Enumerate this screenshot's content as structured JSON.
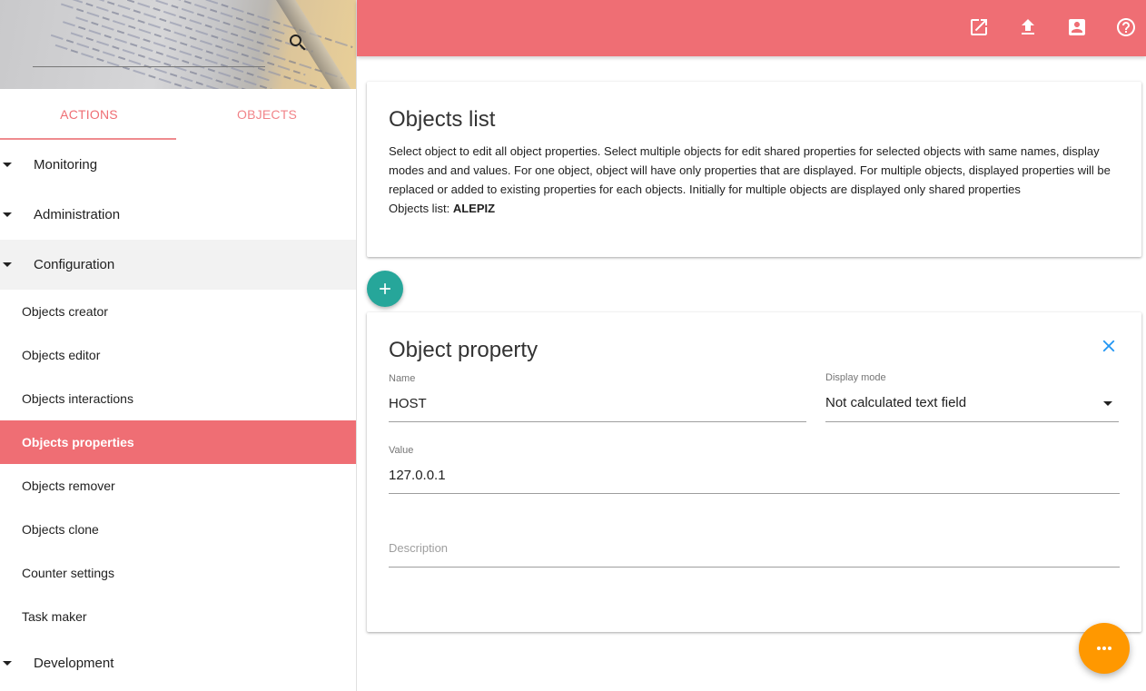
{
  "sidebar": {
    "tabs": {
      "actions": "ACTIONS",
      "objects": "OBJECTS"
    },
    "groups": {
      "monitoring": "Monitoring",
      "administration": "Administration",
      "configuration": "Configuration",
      "development": "Development"
    },
    "items": [
      "Objects creator",
      "Objects editor",
      "Objects interactions",
      "Objects properties",
      "Objects remover",
      "Objects clone",
      "Counter settings",
      "Task maker"
    ],
    "selected_item": "Objects properties"
  },
  "topbar": {
    "icons": [
      "open-in-new-icon",
      "upload-icon",
      "contact-card-icon",
      "help-icon"
    ],
    "color": "#ef6e74"
  },
  "objects_list_card": {
    "title": "Objects list",
    "description": "Select object to edit all object properties. Select multiple objects for edit shared properties for selected objects with same names, display modes and and values. For one object, object will have only properties that are displayed. For multiple objects, displayed properties will be replaced or added to existing properties for each objects. Initially for multiple objects are displayed only shared properties",
    "objects_label": "Objects list:",
    "objects_value": "ALEPIZ"
  },
  "property_card": {
    "title": "Object property",
    "name_label": "Name",
    "name_value": "HOST",
    "display_mode_label": "Display mode",
    "display_mode_value": "Not calculated text field",
    "value_label": "Value",
    "value_value": "127.0.0.1",
    "description_placeholder": "Description"
  },
  "colors": {
    "accent": "#ef6e74",
    "fab_add": "#26a69a",
    "fab_more": "#ff9800",
    "close_icon": "#2196f3"
  }
}
